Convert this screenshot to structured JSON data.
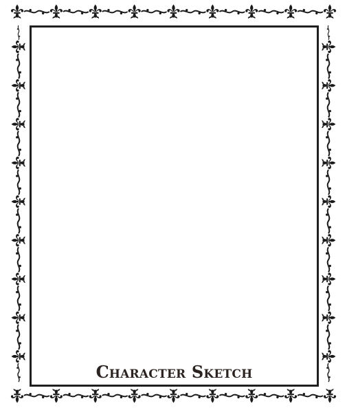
{
  "page": {
    "caption": "Character Sketch"
  },
  "colors": {
    "frame": "#1f1f1f",
    "ornament": "#1a1a1a",
    "caption": "#2b2320",
    "background": "#ffffff"
  },
  "icons": {
    "ornament": "fleur-de-lis-icon"
  }
}
